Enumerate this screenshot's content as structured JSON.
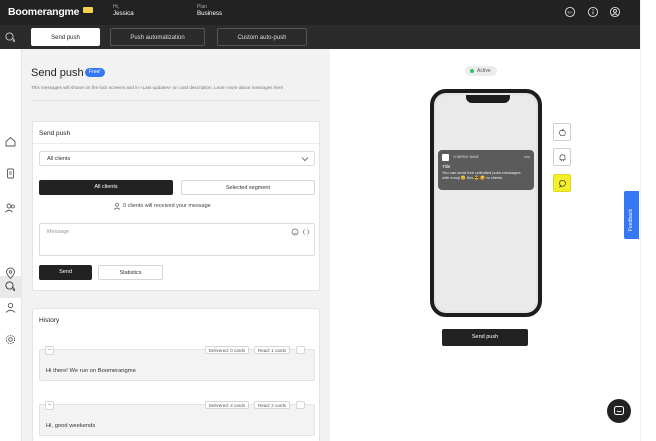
{
  "header": {
    "logo": "Boomerangme",
    "user_caption": "Hi,",
    "user_name": "Jessica",
    "plan_caption": "Plan",
    "plan_name": "Business"
  },
  "tabs": [
    {
      "label": "Send push",
      "active": true
    },
    {
      "label": "Push automatization",
      "active": false
    },
    {
      "label": "Custom auto-push",
      "active": false
    }
  ],
  "page": {
    "title": "Send push",
    "badge": "Free!",
    "description": "This messages will shown on the lock screens and in «Last updates» on card description. Learn more about messages here"
  },
  "send_card": {
    "title": "Send push",
    "audience_select": "All clients",
    "segment_all": "All clients",
    "segment_selected": "Selected segment",
    "recipients_text": "0 clients will received your message",
    "message_placeholder": "Message",
    "send_label": "Send",
    "statistics_label": "Statistics"
  },
  "history": {
    "title": "History",
    "items": [
      {
        "delivered": "Delivered: 0 cards",
        "read": "Read: 1 cards",
        "text": "Hi there! We run on Boomerangme"
      },
      {
        "delivered": "Delivered: 2 cards",
        "read": "Read: 2 cards",
        "text": "Hi, good weekends"
      }
    ]
  },
  "preview": {
    "status": "Active",
    "notification": {
      "app_name": "COMPANY NAME",
      "time": "now",
      "title": "Title",
      "body": "You can send free unlimited push-messages with emoji 😊 this 😎 😋 to clients"
    },
    "send_button": "Send push"
  },
  "feedback_label": "Feedback",
  "colors": {
    "topbar": "#222222",
    "accent_blue": "#3478f6",
    "selected_os": "#f5ee2a",
    "active_green": "#38c172"
  }
}
